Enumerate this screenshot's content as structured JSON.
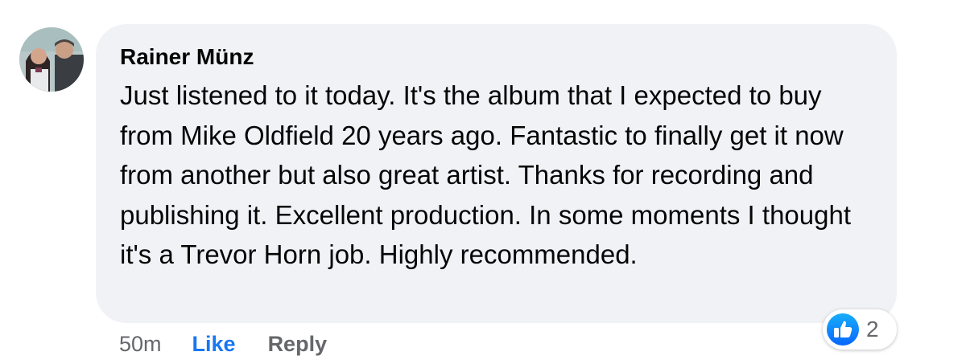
{
  "comment": {
    "author": "Rainer Münz",
    "text": "Just listened to it today. It's the album that I expected to buy from Mike Oldfield 20 years ago. Fantastic to finally get it now from another but also great artist. Thanks for recording and publishing it. Excellent production. In some moments I thought it's a Trevor Horn job. Highly recommended.",
    "timestamp": "50m",
    "like_label": "Like",
    "reply_label": "Reply",
    "reactions": {
      "icon": "thumbs-up-icon",
      "count": "2"
    }
  },
  "colors": {
    "bubble": "#f0f2f5",
    "text": "#050505",
    "secondary": "#65676b",
    "accent": "#1877f2"
  }
}
